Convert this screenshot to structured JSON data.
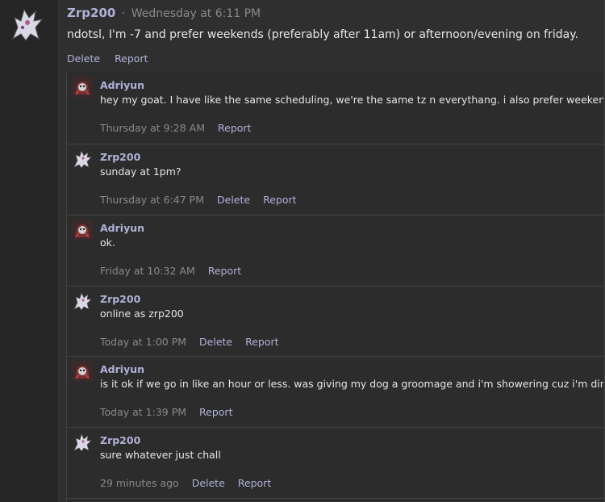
{
  "main_post": {
    "author": "Zrp200",
    "separator": "·",
    "time": "Wednesday at 6:11 PM",
    "text": "ndotsl, I'm -7 and prefer weekends (preferably after 11am) or afternoon/evening on friday.",
    "actions": [
      "Delete",
      "Report"
    ]
  },
  "replies": [
    {
      "author": "Adriyun",
      "avatar": "red-creature-avatar",
      "text": "hey my goat. I have like the same scheduling, we're the same tz n everythang. i also prefer weekends",
      "time": "Thursday at 9:28 AM",
      "actions": [
        "Report"
      ]
    },
    {
      "author": "Zrp200",
      "avatar": "white-creature-avatar",
      "text": "sunday at 1pm?",
      "time": "Thursday at 6:47 PM",
      "actions": [
        "Delete",
        "Report"
      ]
    },
    {
      "author": "Adriyun",
      "avatar": "red-creature-avatar",
      "text": "ok.",
      "time": "Friday at 10:32 AM",
      "actions": [
        "Report"
      ]
    },
    {
      "author": "Zrp200",
      "avatar": "white-creature-avatar",
      "text": "online as zrp200",
      "time": "Today at 1:00 PM",
      "actions": [
        "Delete",
        "Report"
      ]
    },
    {
      "author": "Adriyun",
      "avatar": "red-creature-avatar",
      "text": "is it ok if we go in like an hour or less. was giving my dog a groomage and i'm showering cuz i'm dirty",
      "time": "Today at 1:39 PM",
      "actions": [
        "Report"
      ]
    },
    {
      "author": "Zrp200",
      "avatar": "white-creature-avatar",
      "text": "sure whatever just chall",
      "time": "29 minutes ago",
      "actions": [
        "Delete",
        "Report"
      ]
    }
  ],
  "colors": {
    "link": "#b1b1d9",
    "muted": "#8a8a8a",
    "text": "#e6e6e6",
    "background": "#2f2f2f"
  }
}
